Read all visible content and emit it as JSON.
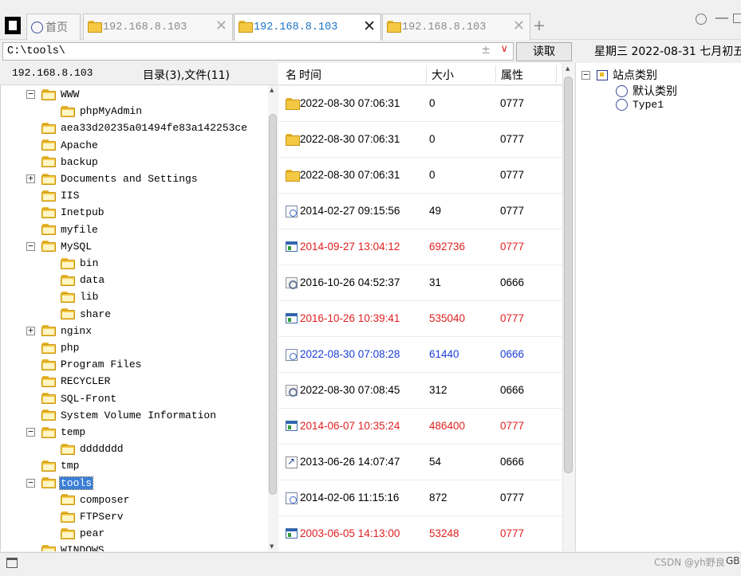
{
  "tabs": [
    {
      "label": "首页",
      "kind": "home"
    },
    {
      "label": "192.168.8.103",
      "close": "✕"
    },
    {
      "label": "192.168.8.103",
      "close": "✕",
      "active": true
    },
    {
      "label": "192.168.8.103",
      "close": "✕"
    }
  ],
  "new_tab": "+",
  "window": {
    "dash": "—"
  },
  "path_bar": {
    "value": "C:\\tools\\",
    "plusminus": "±",
    "dropdown": "∨"
  },
  "read_button": "读取",
  "date_line": "星期三 2022-08-31 七月初五",
  "left_header": {
    "host": "192.168.8.103",
    "summary": "目录(3),文件(11)"
  },
  "tree": [
    {
      "label": "WWW",
      "expander": "−"
    },
    {
      "label": "phpMyAdmin"
    },
    {
      "label": "aea33d20235a01494fe83a142253ce"
    },
    {
      "label": "Apache"
    },
    {
      "label": "backup"
    },
    {
      "label": "Documents and Settings",
      "expander": "+"
    },
    {
      "label": "IIS"
    },
    {
      "label": "Inetpub"
    },
    {
      "label": "myfile"
    },
    {
      "label": "MySQL",
      "expander": "−"
    },
    {
      "label": "bin"
    },
    {
      "label": "data"
    },
    {
      "label": "lib"
    },
    {
      "label": "share"
    },
    {
      "label": "nginx",
      "expander": "+"
    },
    {
      "label": "php"
    },
    {
      "label": "Program Files"
    },
    {
      "label": "RECYCLER"
    },
    {
      "label": "SQL-Front"
    },
    {
      "label": "System Volume Information"
    },
    {
      "label": "temp",
      "expander": "−"
    },
    {
      "label": "ddddddd"
    },
    {
      "label": "tmp"
    },
    {
      "label": "tools",
      "expander": "−",
      "selected": true
    },
    {
      "label": "composer"
    },
    {
      "label": "FTPServ"
    },
    {
      "label": "pear"
    },
    {
      "label": "WINDOWS"
    }
  ],
  "file_list": {
    "columns": {
      "name": "名",
      "time": "时间",
      "size": "大小",
      "attr": "属性"
    },
    "rows": [
      {
        "time": "2022-08-30 07:06:31",
        "size": "0",
        "attr": "0777",
        "icon": "folder-icon",
        "color": "#000000"
      },
      {
        "time": "2022-08-30 07:06:31",
        "size": "0",
        "attr": "0777",
        "icon": "folder-icon",
        "color": "#000000"
      },
      {
        "time": "2022-08-30 07:06:31",
        "size": "0",
        "attr": "0777",
        "icon": "folder-icon",
        "color": "#000000"
      },
      {
        "time": "2014-02-27 09:15:56",
        "size": "49",
        "attr": "0777",
        "icon": "file-icon",
        "color": "#000000"
      },
      {
        "time": "2014-09-27 13:04:12",
        "size": "692736",
        "attr": "0777",
        "icon": "exe-icon",
        "color": "#e02020"
      },
      {
        "time": "2016-10-26 04:52:37",
        "size": "31",
        "attr": "0666",
        "icon": "config-icon",
        "color": "#000000"
      },
      {
        "time": "2016-10-26 10:39:41",
        "size": "535040",
        "attr": "0777",
        "icon": "exe-icon",
        "color": "#e02020"
      },
      {
        "time": "2022-08-30 07:08:28",
        "size": "61440",
        "attr": "0666",
        "icon": "file-icon",
        "color": "#1a3fd6"
      },
      {
        "time": "2022-08-30 07:08:45",
        "size": "312",
        "attr": "0666",
        "icon": "config-icon",
        "color": "#000000"
      },
      {
        "time": "2014-06-07 10:35:24",
        "size": "486400",
        "attr": "0777",
        "icon": "exe-icon",
        "color": "#e02020"
      },
      {
        "time": "2013-06-26 14:07:47",
        "size": "54",
        "attr": "0666",
        "icon": "shortcut-icon",
        "color": "#000000"
      },
      {
        "time": "2014-02-06 11:15:16",
        "size": "872",
        "attr": "0777",
        "icon": "file-icon",
        "color": "#000000"
      },
      {
        "time": "2003-06-05 14:13:00",
        "size": "53248",
        "attr": "0777",
        "icon": "exe-icon",
        "color": "#e02020"
      }
    ]
  },
  "site_tree": {
    "root": {
      "label": "站点类别",
      "expander": "−"
    },
    "children": [
      {
        "label": "默认类别"
      },
      {
        "label": "Type1"
      }
    ]
  },
  "status_bar": {
    "watermark": "CSDN @yh野良",
    "encoding": "GB"
  }
}
